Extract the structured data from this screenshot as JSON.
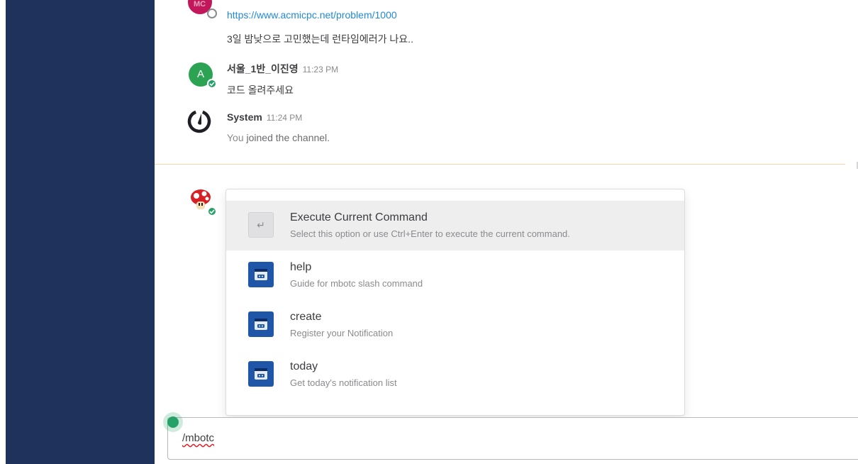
{
  "messages": [
    {
      "link": "https://www.acmicpc.net/problem/1000",
      "text": "3일 밤낮으로 고민했는데 런타임에러가 나요.."
    },
    {
      "avatar_letter": "A",
      "author": "서울_1반_이진영",
      "time": "11:23 PM",
      "text": "코드 올려주세요"
    },
    {
      "author": "System",
      "time": "11:24 PM",
      "text_pre": "You ",
      "text_em": "joined the channel.",
      "avatar_icon": "mattermost-logo-icon"
    }
  ],
  "suggestions": [
    {
      "title": "Execute Current Command",
      "description": "Select this option or use Ctrl+Enter to execute the current command.",
      "icon": "enter-key-icon",
      "glyph": "↵",
      "selected": true
    },
    {
      "title": "help",
      "description": "Guide for mbotc slash command",
      "icon": "bot-icon"
    },
    {
      "title": "create",
      "description": "Register your Notification",
      "icon": "bot-icon"
    },
    {
      "title": "today",
      "description": "Get today's notification list",
      "icon": "bot-icon"
    }
  ],
  "input": {
    "value": "/mbotc"
  },
  "colors": {
    "sidebar": "#1e325c",
    "link": "#2389d7",
    "online": "#06d6a0",
    "online_dot": "#26a269",
    "bot_icon": "#1f56a8",
    "avatar_green": "#2ca352",
    "new_messages_line": "#f2d7a6"
  }
}
